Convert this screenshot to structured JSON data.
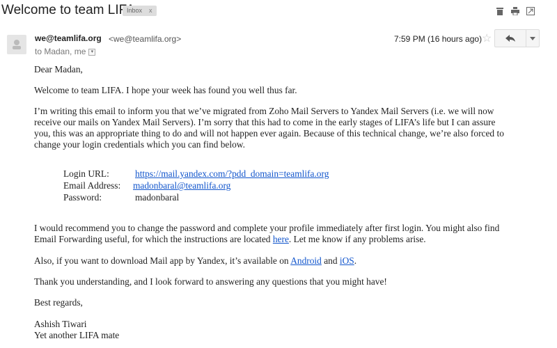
{
  "subject": "Welcome to team LIFA",
  "label": {
    "text": "Inbox",
    "remove": "x"
  },
  "toolbar_icons": [
    "trash-icon",
    "print-icon",
    "new-window-icon"
  ],
  "sender": {
    "name": "we@teamlifa.org",
    "email": "<we@teamlifa.org>"
  },
  "recipients": "to Madan, me",
  "timestamp": "7:59 PM (16 hours ago)",
  "body": {
    "greeting": "Dear Madan,",
    "p1": "Welcome to team LIFA. I hope your week has found you well thus far.",
    "p2_l1": "I’m writing this email to inform you that we’ve migrated from Zoho Mail Servers to Yandex Mail Servers (i.e. we will now",
    "p2_l2": "receive our mails on Yandex Mail Servers). I’m sorry that this had to come in the early stages of LIFA’s life but I can assure",
    "p2_l3": "you, this was an appropriate thing to do and will not happen ever again. Because of this technical change, we’re also forced to",
    "p2_l4": "change your login credentials which you can find below.",
    "login_url_label": "Login URL:",
    "login_url": "https://mail.yandex.com/?pdd_domain=teamlifa.org",
    "email_label": "Email Address:",
    "email": "madonbaral@teamlifa.org",
    "password_label": "Password:",
    "password": "madonbaral",
    "p3_l1": "I would recommend you to change the password and complete your profile immediately after first login. You might also find",
    "p3_l2_pre": "Email Forwarding useful, for which the instructions are located ",
    "p3_link": "here",
    "p3_l2_post": ". Let me know if any problems arise.",
    "p4_pre": "Also, if you want to download Mail app by Yandex, it’s available on ",
    "p4_android": "Android",
    "p4_mid": " and ",
    "p4_ios": "iOS",
    "p4_post": ".",
    "p5": "Thank you understanding, and I look forward to answering any questions that you might have!",
    "closing": "Best regards,",
    "sig_name": "Ashish Tiwari",
    "sig_title": "Yet another LIFA mate"
  },
  "colors": {
    "link": "#1155cc",
    "label_bg": "#dddddd",
    "icon": "#666666"
  }
}
